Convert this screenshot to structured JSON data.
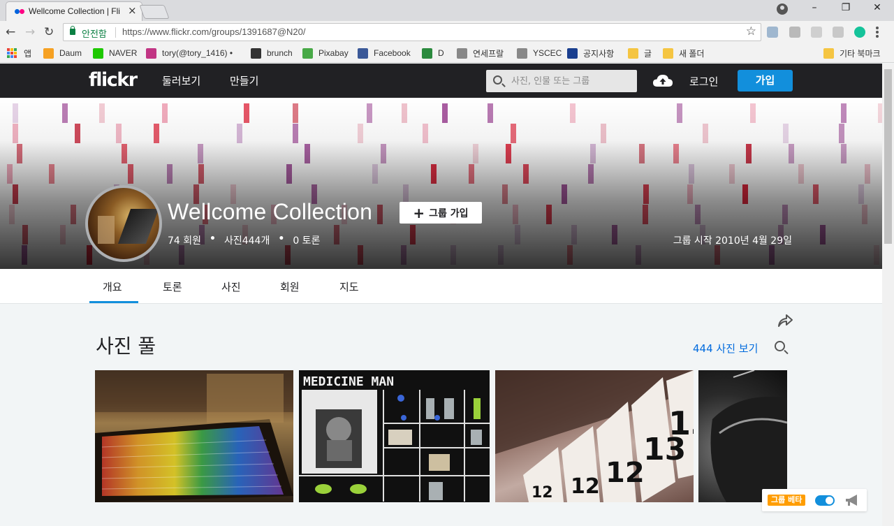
{
  "browser": {
    "tab": {
      "title": "Wellcome Collection | Fli",
      "close": "×"
    },
    "window": {
      "minimize": "–",
      "restore": "❐",
      "close": "✕"
    },
    "nav": {
      "back": "←",
      "forward": "→",
      "reload": "↻"
    },
    "omnibox": {
      "secure_label": "안전함",
      "url": "https://www.flickr.com/groups/1391687@N20/",
      "bookmark_star": "☆"
    },
    "bookmarks": [
      {
        "label": "앱",
        "color": "#e8453c"
      },
      {
        "label": "Daum",
        "color": "#f6a123"
      },
      {
        "label": "NAVER",
        "color": "#1ec800"
      },
      {
        "label": "tory(@tory_1416) •",
        "color": "#c13584"
      },
      {
        "label": "brunch",
        "color": "#333333"
      },
      {
        "label": "Pixabay",
        "color": "#48a947"
      },
      {
        "label": "Facebook",
        "color": "#3b5998"
      },
      {
        "label": "D",
        "color": "#2b8a3e"
      },
      {
        "label": "연세프랄",
        "color": "#888888"
      },
      {
        "label": "YSCEC",
        "color": "#888888"
      },
      {
        "label": "공지사항",
        "color": "#1a3f8f"
      },
      {
        "label": "글",
        "color": "#f5c542"
      },
      {
        "label": "새 폴더",
        "color": "#f5c542"
      },
      {
        "label": "기타 북마크",
        "color": "#f5c542"
      }
    ]
  },
  "flickr": {
    "header": {
      "logo": "flickr",
      "explore": "둘러보기",
      "create": "만들기",
      "search_placeholder": "사진, 인물 또는 그룹",
      "login": "로그인",
      "signup": "가입"
    },
    "group": {
      "name": "Wellcome Collection",
      "join_label": "그룹 가입",
      "members": "74 회원",
      "photos": "사진444개",
      "discussions": "0 토론",
      "since": "그룹 시작 2010년 4월 29일"
    },
    "tabs": [
      "개요",
      "토론",
      "사진",
      "회원",
      "지도"
    ],
    "active_tab": "개요",
    "pool": {
      "title": "사진 풀",
      "view_all": "444 사진 보기"
    },
    "photo_texts": {
      "medicine_man": "MEDICINE MAN",
      "drawer_12": "12",
      "drawer_13": "13"
    },
    "beta": {
      "label": "그룹 베타",
      "enabled": true
    },
    "colors": {
      "brand_blue": "#128fdc",
      "nav_bg": "#212124",
      "beta_orange": "#ff9d00",
      "link_blue": "#006add"
    }
  }
}
